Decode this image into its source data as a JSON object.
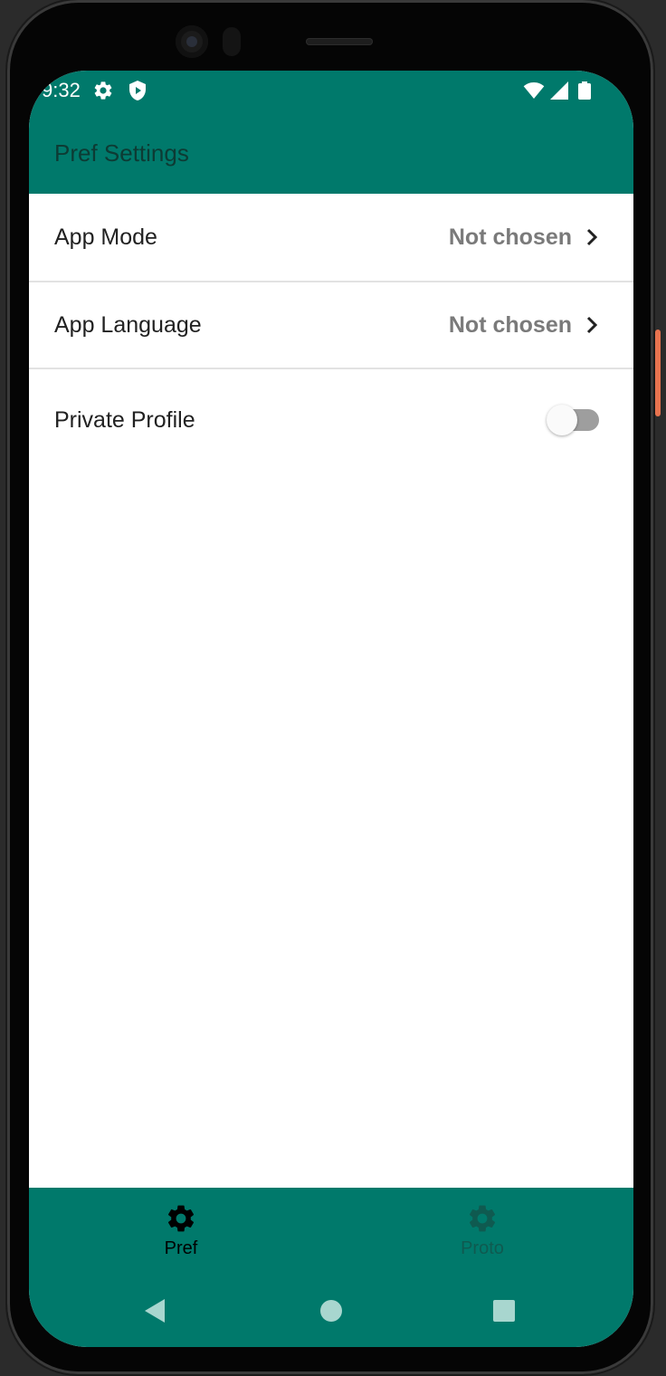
{
  "status_bar": {
    "time": "9:32",
    "left_icons": [
      "gear-icon",
      "shield-icon"
    ],
    "right_icons": [
      "wifi-icon",
      "signal-icon",
      "battery-icon"
    ]
  },
  "app_bar": {
    "title": "Pref Settings"
  },
  "preferences": [
    {
      "label": "App Mode",
      "value": "Not chosen",
      "type": "list"
    },
    {
      "label": "App Language",
      "value": "Not chosen",
      "type": "list"
    },
    {
      "label": "Private Profile",
      "type": "switch",
      "checked": false
    }
  ],
  "bottom_nav": {
    "items": [
      {
        "label": "Pref",
        "icon": "gear-icon",
        "selected": true
      },
      {
        "label": "Proto",
        "icon": "gear-icon",
        "selected": false
      }
    ]
  },
  "system_nav": [
    "back-button",
    "home-button",
    "recents-button"
  ],
  "colors": {
    "primary": "#00796b",
    "nav_selected": "#000000",
    "nav_unselected": "#0f5a50",
    "value_text": "#7a7a7a",
    "label_text": "#212121",
    "system_nav_buttons": "#a8d6cf"
  }
}
